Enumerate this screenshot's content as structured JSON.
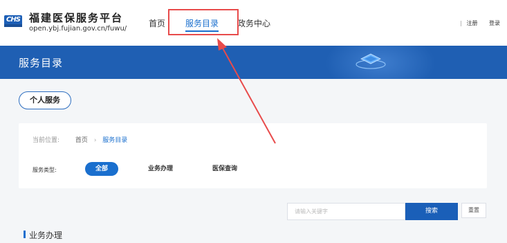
{
  "header": {
    "logo_text": "CHS",
    "title": "福建医保服务平台",
    "url": "open.ybj.fujian.gov.cn/fuwu/",
    "nav": [
      {
        "label": "首页"
      },
      {
        "label": "服务目录"
      },
      {
        "label": "政务中心"
      }
    ],
    "register": "注册",
    "login": "登录"
  },
  "banner": {
    "title": "服务目录"
  },
  "personal_service": "个人服务",
  "breadcrumb": {
    "prefix": "当前位置:",
    "home": "首页",
    "arrow": "›",
    "current": "服务目录"
  },
  "filter": {
    "label": "服务类型:",
    "options": [
      {
        "label": "全部"
      },
      {
        "label": "业务办理"
      },
      {
        "label": "医保查询"
      }
    ]
  },
  "search": {
    "placeholder": "请输入关键字",
    "button": "搜索",
    "reset": "重置"
  },
  "section": {
    "title": "业务办理"
  },
  "colors": {
    "primary": "#1a6fce",
    "banner": "#1f5fb3",
    "annotation": "#e84b4b"
  }
}
